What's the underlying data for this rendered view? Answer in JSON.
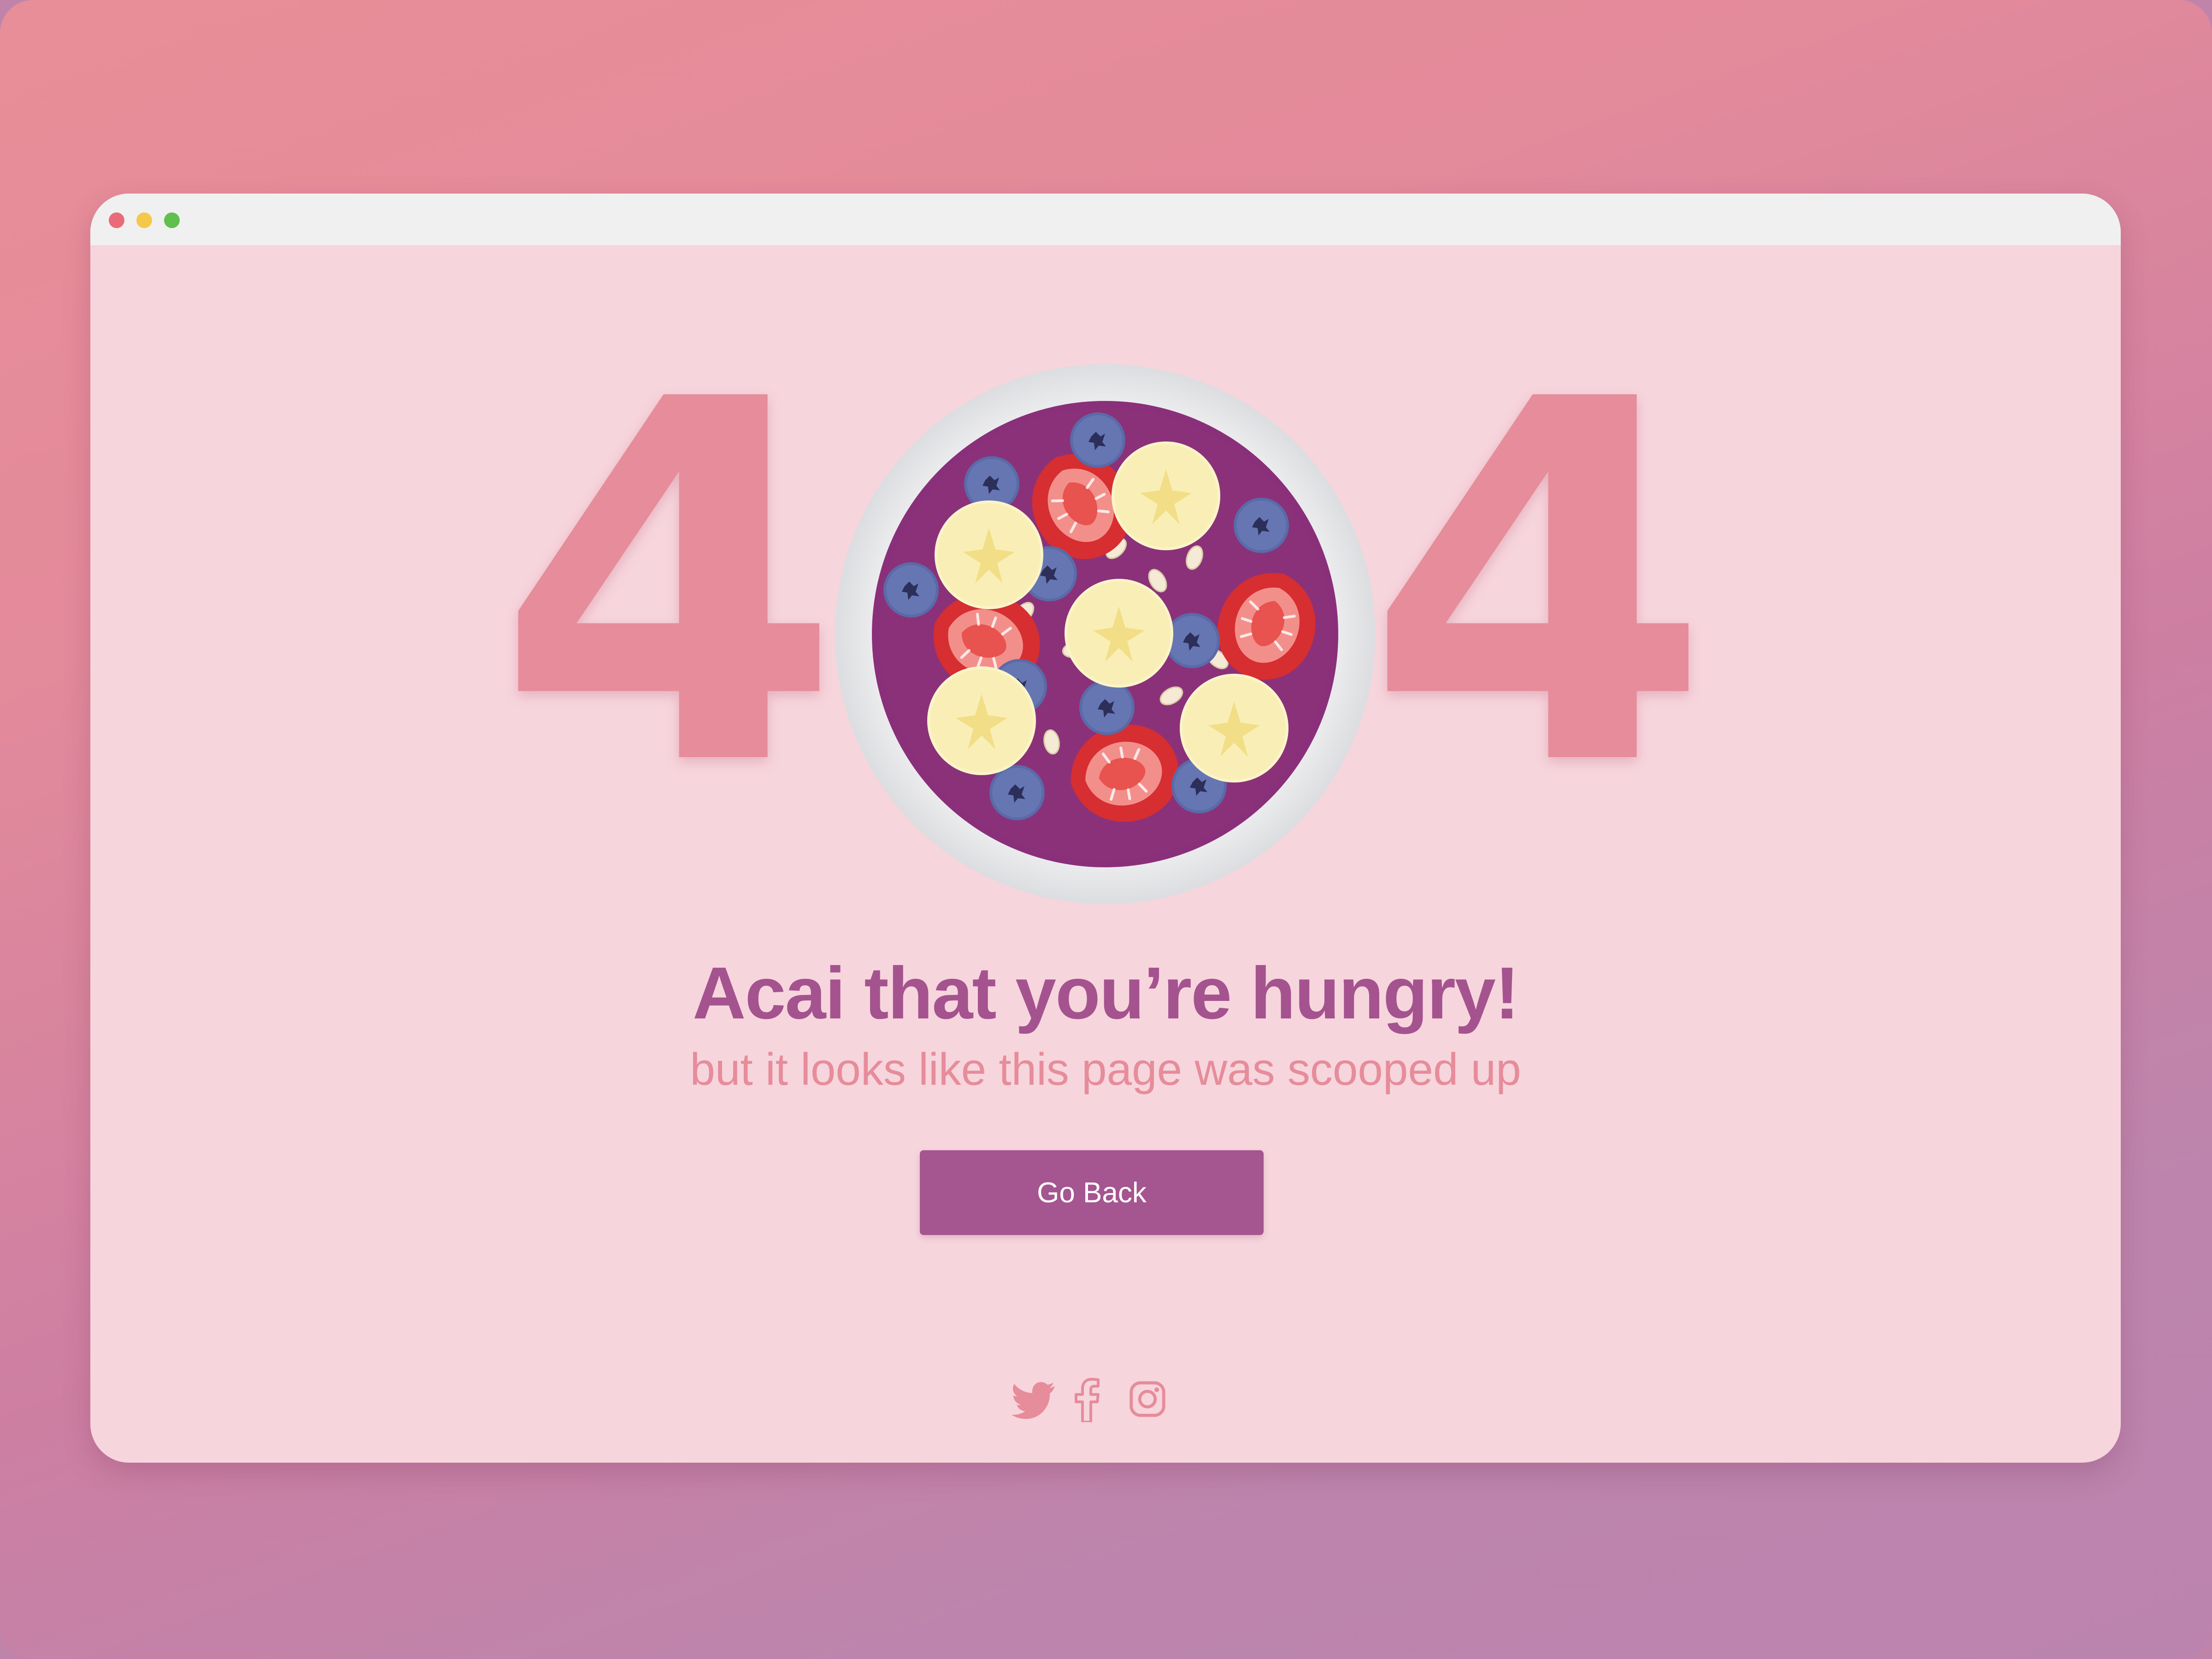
{
  "error": {
    "digit_left": "4",
    "digit_right": "4",
    "headline": "Acai that you’re hungry!",
    "subline": "but it looks like this page was scooped up"
  },
  "actions": {
    "go_back_label": "Go Back"
  },
  "social": [
    "twitter-icon",
    "facebook-icon",
    "instagram-icon"
  ],
  "colors": {
    "accent": "#a5558f",
    "digit": "#e68c9a",
    "page_background": "#f7d5dd",
    "titlebar": "#f1f0f0"
  }
}
